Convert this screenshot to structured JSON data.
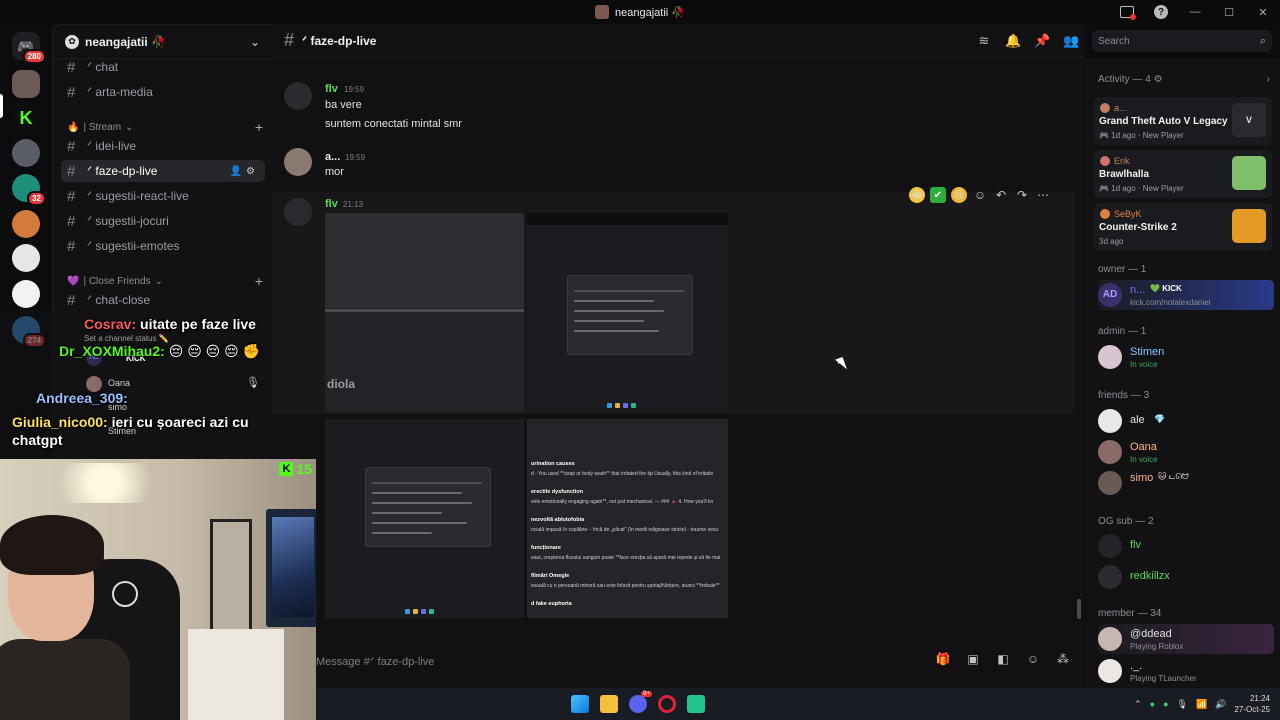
{
  "window": {
    "title": "neangajatii 🥀"
  },
  "server": {
    "name": "neangajatii 🥀",
    "home_badge": "280"
  },
  "guild_badges": {
    "g1": "32",
    "g2": "274"
  },
  "channels": [
    {
      "name": "ᐟ chat"
    },
    {
      "name": "ᐟ arta-media"
    },
    {
      "category": "| Stream"
    },
    {
      "name": "ᐟ idei-live"
    },
    {
      "name": "ᐟ faze-dp-live",
      "selected": true
    },
    {
      "name": "ᐟ sugestii-react-live"
    },
    {
      "name": "ᐟ sugestii-jocuri"
    },
    {
      "name": "ᐟ sugestii-emotes"
    },
    {
      "category": "| Close Friends"
    },
    {
      "name": "ᐟ chat-close"
    }
  ],
  "current_channel": {
    "name": "ᐟ faze-dp-live",
    "composer_placeholder": "Message #ᐟ faze-dp-live"
  },
  "search": {
    "placeholder": "Search"
  },
  "messages": [
    {
      "author": "flv",
      "time": "19:59",
      "lines": [
        "ba vere",
        "suntem conectati mintal smr"
      ],
      "color": "#5ad85a"
    },
    {
      "author": "a...",
      "time": "19:59",
      "lines": [
        "mor"
      ],
      "color": "#e8e8e8"
    },
    {
      "author": "flv",
      "time": "21:13",
      "lines": [],
      "color": "#5ad85a"
    }
  ],
  "attachments": {
    "img1_word": "diola",
    "img4_lines": [
      "urination causes",
      "d - You used **soap or body wash** that irritated the tip Usually, this kind of irritatio",
      "erectile dysfunction",
      "eels emotionally engaging again**, not just mechanical. — ### 🔺 4. How you'll kn",
      "nezvoltă ablutofobia",
      "ocială impusă în copilărie: - frică de „păcat\" (în medii religioase stricte) - traume sexu",
      "funcționare",
      "eaut, creșterea fluxului sanguin poate **face erecția să apară mai repede și să fie mai",
      "filmări Omegle",
      "exuală cu o persoană minoră sau este folosit pentru șantaj/hărțuire, atunci **trebuie**",
      "d fake euphoria"
    ]
  },
  "members_panel": {
    "activity_header": "Activity — 4",
    "activities": [
      {
        "user": "a...",
        "game": "Grand Theft Auto V Legacy",
        "sub": "1d ago",
        "tag": "New Player",
        "color": "#c08060"
      },
      {
        "user": "Erik",
        "game": "Brawlhalla",
        "sub": "1d ago",
        "tag": "New Player",
        "color": "#c08060"
      },
      {
        "user": "SeByK",
        "game": "Counter-Strike 2",
        "sub": "3d ago",
        "tag": "",
        "color": "#e08040"
      }
    ],
    "sections": [
      {
        "title": "owner — 1",
        "members": [
          {
            "name": "n...",
            "status": "kick.com/notalexdaniel",
            "badge": "KICK",
            "color": "#7a6cff"
          }
        ]
      },
      {
        "title": "admin — 1",
        "members": [
          {
            "name": "Stimen",
            "status": "In voice",
            "color": "#8ec6ff"
          }
        ]
      },
      {
        "title": "friends — 3",
        "members": [
          {
            "name": "ale",
            "status": "",
            "color": "#e8e8e8"
          },
          {
            "name": "Oana",
            "status": "In voice",
            "color": "#ffb48a"
          },
          {
            "name": "simo",
            "status": "",
            "color": "#ffb48a"
          }
        ]
      },
      {
        "title": "OG sub — 2",
        "members": [
          {
            "name": "flv",
            "status": "",
            "color": "#5ad85a"
          },
          {
            "name": "redkillzx",
            "status": "",
            "color": "#5ad85a"
          }
        ]
      },
      {
        "title": "member — 34",
        "members": [
          {
            "name": "@ddead",
            "status": "Playing Roblox",
            "color": "#e8e8e8"
          },
          {
            "name": "._.",
            "status": "Playing TLauncher",
            "color": "#e8e8e8"
          }
        ]
      }
    ]
  },
  "overlay_chat": [
    {
      "user": "Cosrav:",
      "text": "uitate pe faze live"
    },
    {
      "user": "Dr_XOXMihau2:",
      "text": "😔 😔 😔 😔 ✊"
    },
    {
      "user": "Andreea_309:",
      "text": ""
    },
    {
      "user": "Giulia_nico00:",
      "text": "ieri cu șoareci azi cu"
    },
    {
      "user": "",
      "text": "chatgpt"
    }
  ],
  "voice_panel": {
    "status_hint": "Set a channel status ✏️",
    "users": [
      "AD",
      "Oana",
      "simo",
      "Stimen"
    ],
    "kick_tag": "KICK"
  },
  "cam": {
    "kick_count": "15"
  },
  "taskbar": {
    "time": "21:24",
    "date": "27-Oct-25",
    "discord_badge": "9+"
  }
}
